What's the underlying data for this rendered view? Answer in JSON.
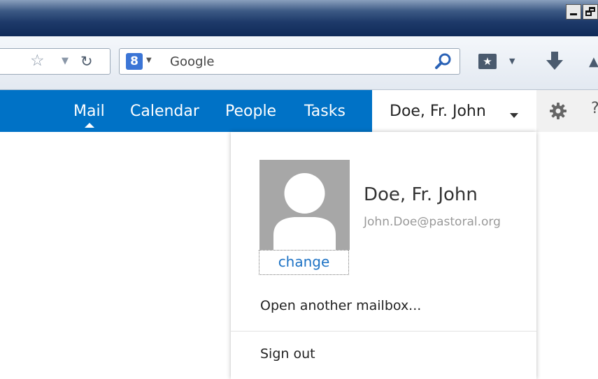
{
  "browser": {
    "search": {
      "engine_icon_letter": "8",
      "placeholder": "Google"
    },
    "icons": [
      "bookmark-star-icon",
      "dropmarker-icon",
      "reload-icon",
      "google-icon",
      "search-icon",
      "bookmarks-icon",
      "download-icon"
    ]
  },
  "nav": {
    "items": [
      {
        "label": "Mail",
        "selected": true
      },
      {
        "label": "Calendar"
      },
      {
        "label": "People"
      },
      {
        "label": "Tasks"
      }
    ],
    "user_label": "Doe, Fr. John",
    "settings_icon": "gear-icon",
    "colors": {
      "accent": "#0072c6"
    }
  },
  "dropdown": {
    "name": "Doe, Fr. John",
    "email": "John.Doe@pastoral.org",
    "change_label": "change",
    "open_mailbox_label": "Open another mailbox...",
    "signout_label": "Sign out"
  }
}
